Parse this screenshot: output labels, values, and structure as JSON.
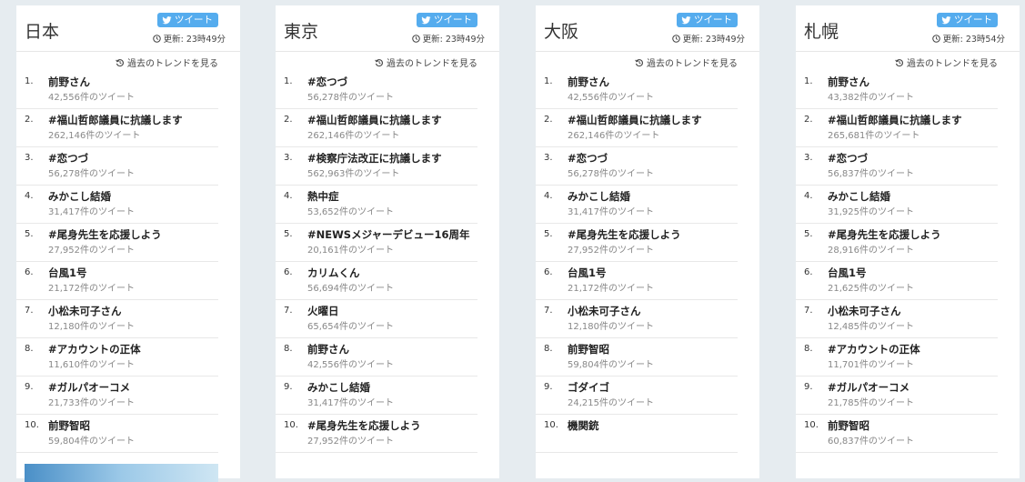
{
  "ui": {
    "tweet_label": "ツイート",
    "updated_prefix": "更新: ",
    "past_trends_label": "過去のトレンドを見る"
  },
  "colors": {
    "page_bg": "#e6ecf0",
    "card_bg": "#ffffff",
    "tweet_button": "#55acee"
  },
  "columns": [
    {
      "city": "日本",
      "updated_time": "23時49分",
      "trends": [
        {
          "rank": "1.",
          "name": "前野さん",
          "count": "42,556件のツイート"
        },
        {
          "rank": "2.",
          "name": "#福山哲郎議員に抗議します",
          "count": "262,146件のツイート"
        },
        {
          "rank": "3.",
          "name": "#恋つづ",
          "count": "56,278件のツイート"
        },
        {
          "rank": "4.",
          "name": "みかこし結婚",
          "count": "31,417件のツイート"
        },
        {
          "rank": "5.",
          "name": "#尾身先生を応援しよう",
          "count": "27,952件のツイート"
        },
        {
          "rank": "6.",
          "name": "台風1号",
          "count": "21,172件のツイート"
        },
        {
          "rank": "7.",
          "name": "小松未可子さん",
          "count": "12,180件のツイート"
        },
        {
          "rank": "8.",
          "name": "#アカウントの正体",
          "count": "11,610件のツイート"
        },
        {
          "rank": "9.",
          "name": "#ガルパオーコメ",
          "count": "21,733件のツイート"
        },
        {
          "rank": "10.",
          "name": "前野智昭",
          "count": "59,804件のツイート"
        }
      ]
    },
    {
      "city": "東京",
      "updated_time": "23時49分",
      "trends": [
        {
          "rank": "1.",
          "name": "#恋つづ",
          "count": "56,278件のツイート"
        },
        {
          "rank": "2.",
          "name": "#福山哲郎議員に抗議します",
          "count": "262,146件のツイート"
        },
        {
          "rank": "3.",
          "name": "#検察庁法改正に抗議します",
          "count": "562,963件のツイート"
        },
        {
          "rank": "4.",
          "name": "熱中症",
          "count": "53,652件のツイート"
        },
        {
          "rank": "5.",
          "name": "#NEWSメジャーデビュー16周年",
          "count": "20,161件のツイート"
        },
        {
          "rank": "6.",
          "name": "カリムくん",
          "count": "56,694件のツイート"
        },
        {
          "rank": "7.",
          "name": "火曜日",
          "count": "65,654件のツイート"
        },
        {
          "rank": "8.",
          "name": "前野さん",
          "count": "42,556件のツイート"
        },
        {
          "rank": "9.",
          "name": "みかこし結婚",
          "count": "31,417件のツイート"
        },
        {
          "rank": "10.",
          "name": "#尾身先生を応援しよう",
          "count": "27,952件のツイート"
        }
      ]
    },
    {
      "city": "大阪",
      "updated_time": "23時49分",
      "trends": [
        {
          "rank": "1.",
          "name": "前野さん",
          "count": "42,556件のツイート"
        },
        {
          "rank": "2.",
          "name": "#福山哲郎議員に抗議します",
          "count": "262,146件のツイート"
        },
        {
          "rank": "3.",
          "name": "#恋つづ",
          "count": "56,278件のツイート"
        },
        {
          "rank": "4.",
          "name": "みかこし結婚",
          "count": "31,417件のツイート"
        },
        {
          "rank": "5.",
          "name": "#尾身先生を応援しよう",
          "count": "27,952件のツイート"
        },
        {
          "rank": "6.",
          "name": "台風1号",
          "count": "21,172件のツイート"
        },
        {
          "rank": "7.",
          "name": "小松未可子さん",
          "count": "12,180件のツイート"
        },
        {
          "rank": "8.",
          "name": "前野智昭",
          "count": "59,804件のツイート"
        },
        {
          "rank": "9.",
          "name": "ゴダイゴ",
          "count": "24,215件のツイート"
        },
        {
          "rank": "10.",
          "name": "機関銃",
          "count": ""
        }
      ]
    },
    {
      "city": "札幌",
      "updated_time": "23時54分",
      "trends": [
        {
          "rank": "1.",
          "name": "前野さん",
          "count": "43,382件のツイート"
        },
        {
          "rank": "2.",
          "name": "#福山哲郎議員に抗議します",
          "count": "265,681件のツイート"
        },
        {
          "rank": "3.",
          "name": "#恋つづ",
          "count": "56,837件のツイート"
        },
        {
          "rank": "4.",
          "name": "みかこし結婚",
          "count": "31,925件のツイート"
        },
        {
          "rank": "5.",
          "name": "#尾身先生を応援しよう",
          "count": "28,916件のツイート"
        },
        {
          "rank": "6.",
          "name": "台風1号",
          "count": "21,625件のツイート"
        },
        {
          "rank": "7.",
          "name": "小松未可子さん",
          "count": "12,485件のツイート"
        },
        {
          "rank": "8.",
          "name": "#アカウントの正体",
          "count": "11,701件のツイート"
        },
        {
          "rank": "9.",
          "name": "#ガルパオーコメ",
          "count": "21,785件のツイート"
        },
        {
          "rank": "10.",
          "name": "前野智昭",
          "count": "60,837件のツイート"
        }
      ]
    }
  ]
}
